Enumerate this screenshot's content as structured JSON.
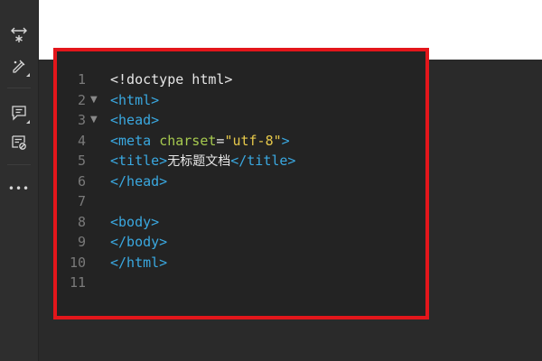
{
  "toolbar": {
    "items": [
      {
        "icon": "expand-icon"
      },
      {
        "icon": "edit-icon"
      },
      {
        "icon": "comment-icon"
      },
      {
        "icon": "snippet-icon"
      },
      {
        "icon": "more-icon",
        "glyph": "•••"
      }
    ]
  },
  "highlight_color": "#e3161b",
  "editor": {
    "lines": [
      {
        "num": "1",
        "fold": "",
        "segments": [
          {
            "text": "<!doctype html>",
            "kind": "txt"
          }
        ]
      },
      {
        "num": "2",
        "fold": "▼",
        "segments": [
          {
            "text": "<html>",
            "kind": "tag"
          }
        ]
      },
      {
        "num": "3",
        "fold": "▼",
        "segments": [
          {
            "text": "<head>",
            "kind": "tag"
          }
        ]
      },
      {
        "num": "4",
        "fold": "",
        "segments": [
          {
            "text": "<meta ",
            "kind": "tag"
          },
          {
            "text": "charset",
            "kind": "attr"
          },
          {
            "text": "=",
            "kind": "txt"
          },
          {
            "text": "\"utf-8\"",
            "kind": "str"
          },
          {
            "text": ">",
            "kind": "tag"
          }
        ]
      },
      {
        "num": "5",
        "fold": "",
        "segments": [
          {
            "text": "<title>",
            "kind": "tag"
          },
          {
            "text": "无标题文档",
            "kind": "cjk"
          },
          {
            "text": "</title>",
            "kind": "tag"
          }
        ]
      },
      {
        "num": "6",
        "fold": "",
        "segments": [
          {
            "text": "</head>",
            "kind": "tag"
          }
        ]
      },
      {
        "num": "7",
        "fold": "",
        "segments": []
      },
      {
        "num": "8",
        "fold": "",
        "segments": [
          {
            "text": "<body>",
            "kind": "tag"
          }
        ]
      },
      {
        "num": "9",
        "fold": "",
        "segments": [
          {
            "text": "</body>",
            "kind": "tag"
          }
        ]
      },
      {
        "num": "10",
        "fold": "",
        "segments": [
          {
            "text": "</html>",
            "kind": "tag"
          }
        ]
      },
      {
        "num": "11",
        "fold": "",
        "segments": []
      }
    ]
  }
}
